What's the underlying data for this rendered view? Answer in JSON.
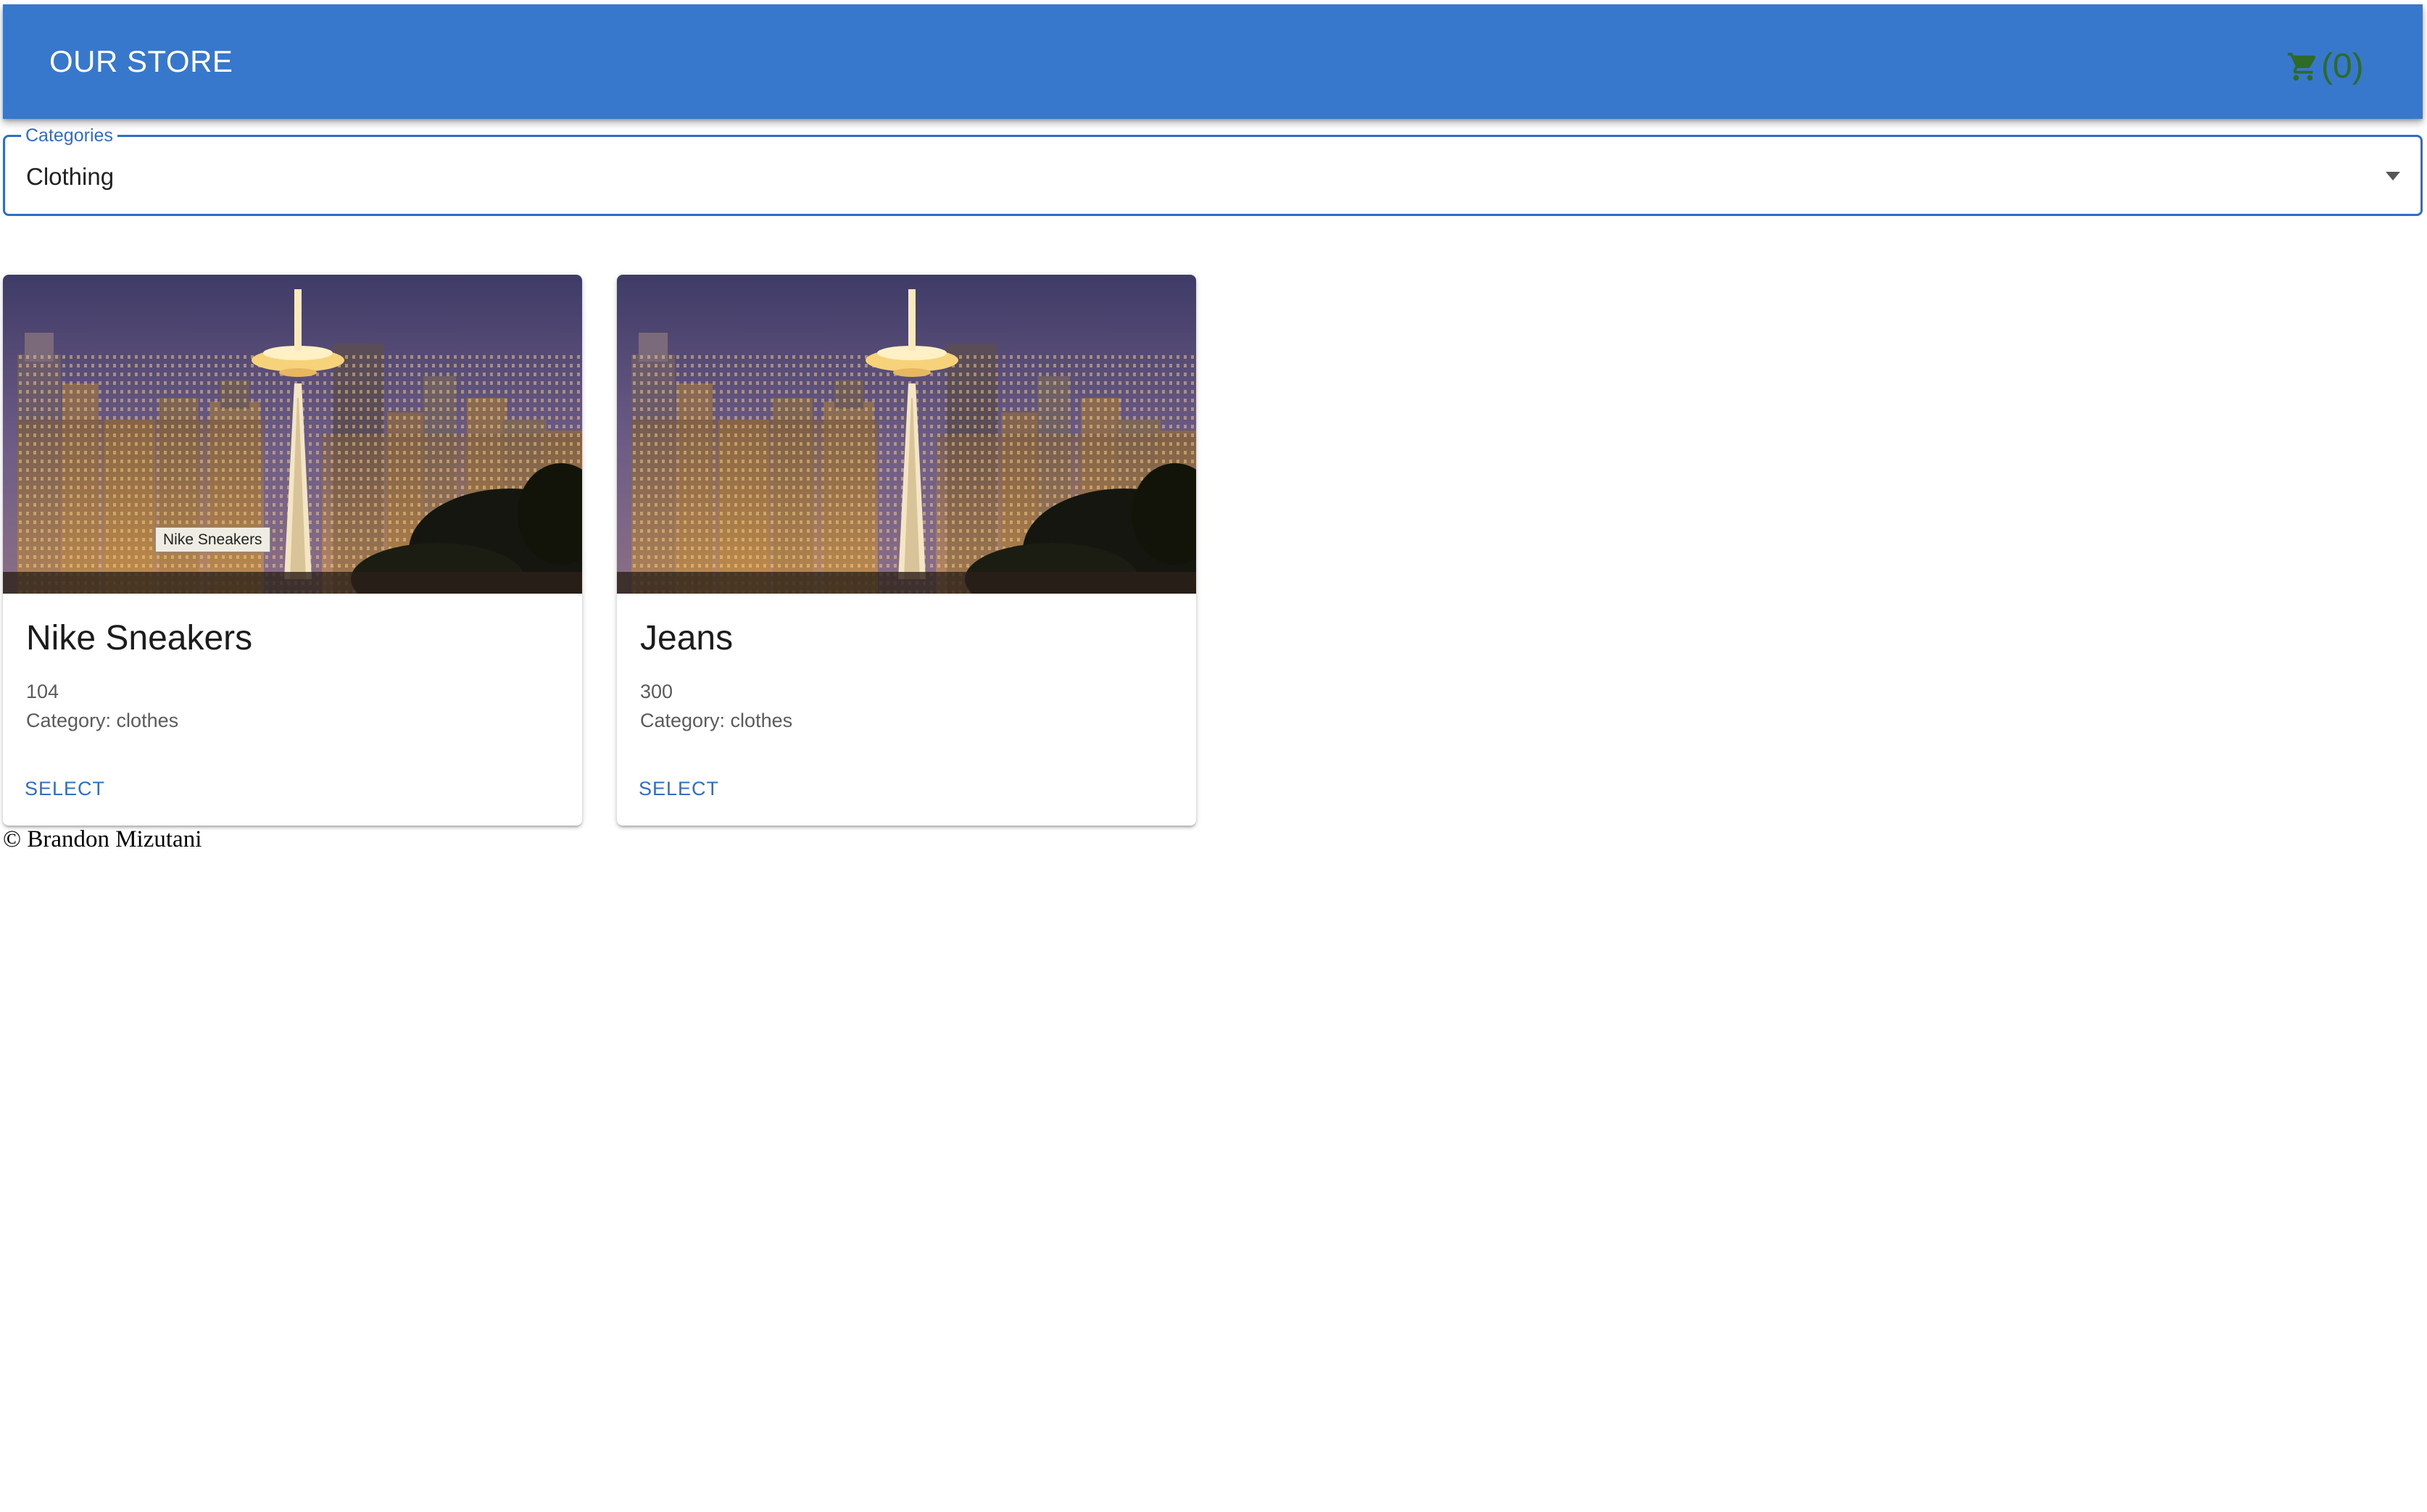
{
  "header": {
    "title": "OUR STORE",
    "cart": {
      "icon": "shopping-cart-icon",
      "count_label": "(0)",
      "color": "#2e6b26"
    },
    "background_color": "#3778cd"
  },
  "categories": {
    "label": "Categories",
    "selected": "Clothing",
    "accent_color": "#2f6ec0",
    "icon": "dropdown-arrow-icon"
  },
  "products": [
    {
      "title": "Nike Sneakers",
      "price": "104",
      "category": "Category: clothes",
      "button_label": "SELECT",
      "image_tooltip": "Nike Sneakers"
    },
    {
      "title": "Jeans",
      "price": "300",
      "category": "Category: clothes",
      "button_label": "SELECT"
    }
  ],
  "footer": {
    "text": "© Brandon Mizutani"
  }
}
